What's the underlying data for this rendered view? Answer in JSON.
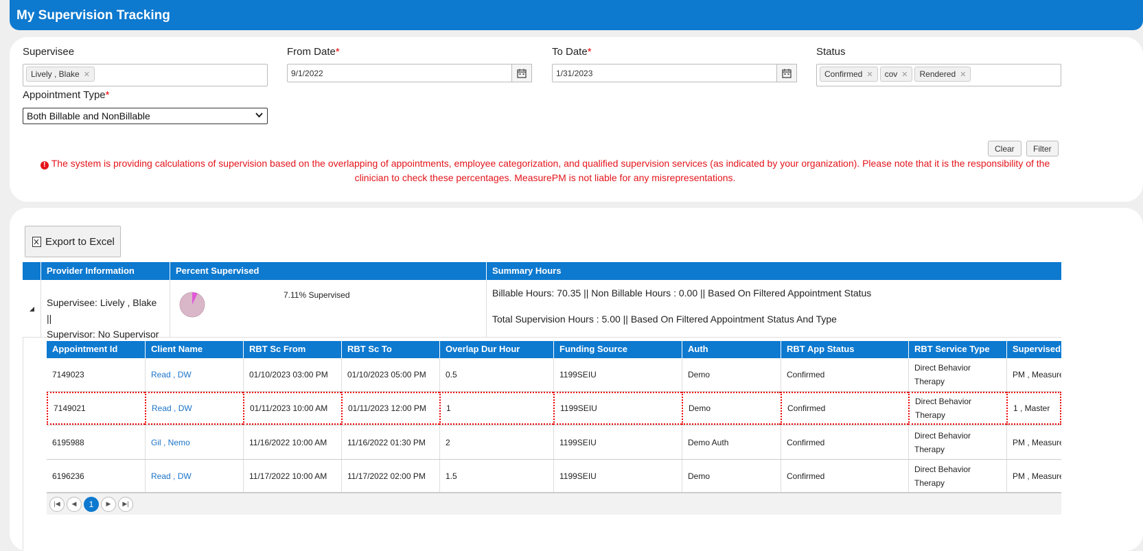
{
  "page": {
    "title": "My Supervision Tracking"
  },
  "filters": {
    "supervisee_label": "Supervisee",
    "supervisee_tags": [
      "Lively , Blake"
    ],
    "from_date_label": "From Date",
    "from_date_value": "9/1/2022",
    "to_date_label": "To Date",
    "to_date_value": "1/31/2023",
    "required_mark": "*",
    "status_label": "Status",
    "status_tags": [
      "Confirmed",
      "cov",
      "Rendered"
    ],
    "appointment_type_label": "Appointment Type",
    "appointment_type_value": "Both Billable and NonBillable",
    "clear_label": "Clear",
    "filter_label": "Filter",
    "notice": "The system is providing calculations of supervision based on the overlapping of appointments, employee categorization, and qualified supervision services (as indicated by your organization). Please note that it is the responsibility of the clinician to check these percentages. MeasurePM is not liable for any misrepresentations."
  },
  "grid": {
    "export_label": "Export to Excel",
    "headers": {
      "provider": "Provider Information",
      "percent": "Percent Supervised",
      "summary": "Summary Hours"
    },
    "row": {
      "supervisee_line": "Supervisee: Lively , Blake ||",
      "supervisor_line": "Supervisor: No Supervisor",
      "percent_text": "7.11% Supervised",
      "percent_value": 7.11,
      "billable_line": "Billable Hours: 70.35 || Non Billable Hours : 0.00 || Based On Filtered Appointment Status",
      "total_line": "Total Supervision Hours : 5.00 || Based On Filtered Appointment Status And Type"
    },
    "detail_headers": [
      "Appointment Id",
      "Client Name",
      "RBT Sc From",
      "RBT Sc To",
      "Overlap Dur Hour",
      "Funding Source",
      "Auth",
      "RBT App Status",
      "RBT Service Type",
      "Supervised"
    ],
    "detail_rows": [
      [
        "7149023",
        "Read , DW",
        "01/10/2023 03:00 PM",
        "01/10/2023 05:00 PM",
        "0.5",
        "1199SEIU",
        "Demo",
        "Confirmed",
        "Direct Behavior Therapy",
        "PM , Measure"
      ],
      [
        "7149021",
        "Read , DW",
        "01/11/2023 10:00 AM",
        "01/11/2023 12:00 PM",
        "1",
        "1199SEIU",
        "Demo",
        "Confirmed",
        "Direct Behavior Therapy",
        "1 , Master"
      ],
      [
        "6195988",
        "Gil , Nemo",
        "11/16/2022 10:00 AM",
        "11/16/2022 01:30 PM",
        "2",
        "1199SEIU",
        "Demo Auth",
        "Confirmed",
        "Direct Behavior Therapy",
        "PM , Measure"
      ],
      [
        "6196236",
        "Read , DW",
        "11/17/2022 10:00 AM",
        "11/17/2022 02:00 PM",
        "1.5",
        "1199SEIU",
        "Demo",
        "Confirmed",
        "Direct Behavior Therapy",
        "PM , Measure"
      ]
    ],
    "pager_current": "1"
  },
  "colors": {
    "brand": "#0d79cf",
    "alert": "#e4141b",
    "link": "#1a73c9",
    "pie": "#d9b7c8",
    "pie_slice": "#e05ad8"
  }
}
